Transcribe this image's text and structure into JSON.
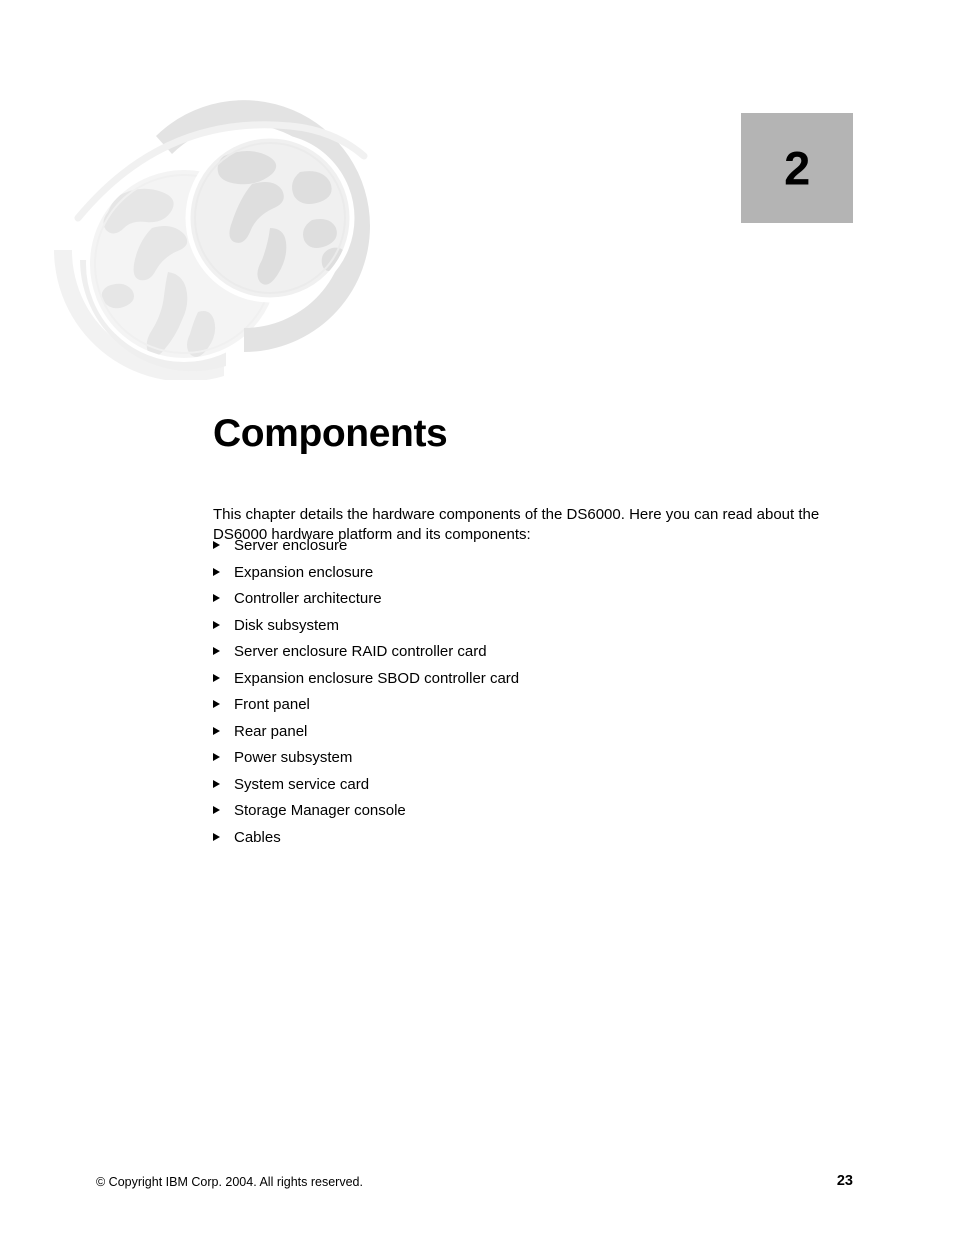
{
  "chapter": {
    "number": "2",
    "title": "Components"
  },
  "intro": {
    "paragraph": "This chapter details the hardware components of the DS6000. Here you can read about the DS6000 hardware platform and its components:"
  },
  "topics": [
    {
      "label": "Server enclosure"
    },
    {
      "label": "Expansion enclosure"
    },
    {
      "label": "Controller architecture"
    },
    {
      "label": "Disk subsystem"
    },
    {
      "label": "Server enclosure RAID controller card"
    },
    {
      "label": "Expansion enclosure SBOD controller card"
    },
    {
      "label": "Front panel"
    },
    {
      "label": "Rear panel"
    },
    {
      "label": "Power subsystem"
    },
    {
      "label": "System service card"
    },
    {
      "label": "Storage Manager console"
    },
    {
      "label": "Cables"
    }
  ],
  "footer": {
    "copyright": "© Copyright IBM Corp. 2004. All rights reserved.",
    "page_number": "23"
  },
  "colors": {
    "chapter_box_background": "#b4b4b4",
    "text": "#000000",
    "page_background": "#ffffff",
    "watermark_light": "#f3f3f3",
    "watermark_mid": "#ececec",
    "watermark_dark": "#e2e2e2"
  }
}
